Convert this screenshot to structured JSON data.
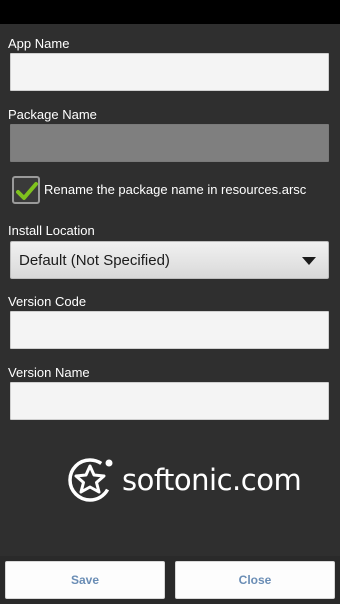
{
  "form": {
    "app_name_label": "App Name",
    "app_name_value": "",
    "package_name_label": "Package Name",
    "package_name_value": "",
    "rename_checkbox_label": "Rename the package name in resources.arsc",
    "rename_checked": true,
    "install_location_label": "Install Location",
    "install_location_value": "Default (Not Specified)",
    "version_code_label": "Version Code",
    "version_code_value": "",
    "version_name_label": "Version Name",
    "version_name_value": ""
  },
  "watermark": {
    "text": "softonic.com",
    "icon": "softonic-star-icon"
  },
  "actions": {
    "save_label": "Save",
    "close_label": "Close"
  },
  "colors": {
    "background": "#2f2f2f",
    "field_bg": "#f4f4f4",
    "disabled_field_bg": "#7f7f7f",
    "button_text": "#6a8db5",
    "check_green": "#7fc21d"
  }
}
